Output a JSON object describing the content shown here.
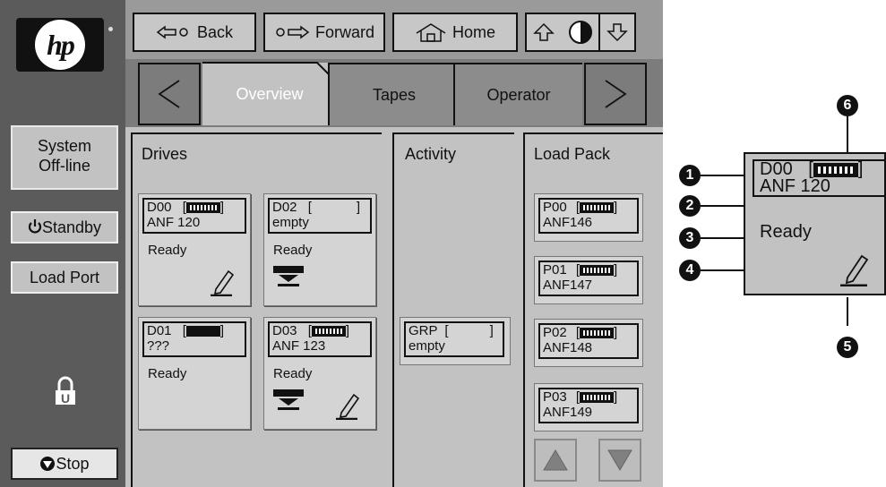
{
  "sidebar": {
    "logo_text": "hp",
    "system_status_line1": "System",
    "system_status_line2": "Off-line",
    "standby_label": "Standby",
    "load_port_label": "Load Port",
    "stop_label": "Stop"
  },
  "nav": {
    "back_label": "Back",
    "forward_label": "Forward",
    "home_label": "Home"
  },
  "tabs": {
    "overview": "Overview",
    "tapes": "Tapes",
    "operator": "Operator"
  },
  "sections": {
    "drives_title": "Drives",
    "activity_title": "Activity",
    "loadpack_title": "Load Pack"
  },
  "drives": [
    {
      "id": "D00",
      "line2": "ANF 120",
      "status": "Ready"
    },
    {
      "id": "D02",
      "line2": "empty",
      "status": "Ready"
    },
    {
      "id": "D01",
      "line2": "???",
      "status": "Ready"
    },
    {
      "id": "D03",
      "line2": "ANF 123",
      "status": "Ready"
    }
  ],
  "activity": {
    "id": "GRP",
    "line2": "empty"
  },
  "loadpack": [
    {
      "id": "P00",
      "line2": "ANF146"
    },
    {
      "id": "P01",
      "line2": "ANF147"
    },
    {
      "id": "P02",
      "line2": "ANF148"
    },
    {
      "id": "P03",
      "line2": "ANF149"
    }
  ],
  "detail": {
    "id": "D00",
    "line2": "ANF 120",
    "status": "Ready",
    "callouts": [
      "1",
      "2",
      "3",
      "4",
      "5",
      "6"
    ]
  }
}
